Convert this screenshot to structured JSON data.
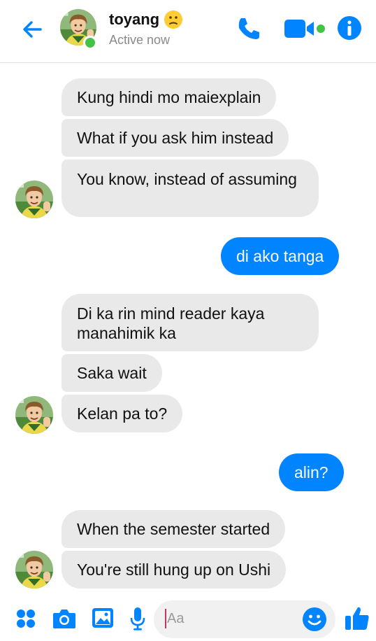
{
  "header": {
    "contact_name": "toyang",
    "status": "Active now",
    "emoji": "confused-face-emoji",
    "icons": [
      "back-arrow-icon",
      "phone-icon",
      "video-camera-icon",
      "info-icon"
    ]
  },
  "colors": {
    "accent": "#0084ff",
    "incoming_bubble": "#e9e9e9",
    "online": "#44c246"
  },
  "messages": [
    {
      "from": "contact",
      "text": "Kung hindi mo maiexplain"
    },
    {
      "from": "contact",
      "text": "What if you ask him instead"
    },
    {
      "from": "contact",
      "text": "You know, instead of assuming"
    },
    {
      "from": "me",
      "text": "di ako tanga"
    },
    {
      "from": "contact",
      "text": "Di ka rin mind reader kaya manahimik ka"
    },
    {
      "from": "contact",
      "text": "Saka wait"
    },
    {
      "from": "contact",
      "text": "Kelan pa to?"
    },
    {
      "from": "me",
      "text": "alin?"
    },
    {
      "from": "contact",
      "text": "When the semester started"
    },
    {
      "from": "contact",
      "text": "You're still hung up on Ushi"
    }
  ],
  "composer": {
    "placeholder": "Aa",
    "icons": [
      "apps-icon",
      "camera-icon",
      "gallery-icon",
      "microphone-icon",
      "emoji-icon",
      "thumbs-up-icon"
    ]
  }
}
